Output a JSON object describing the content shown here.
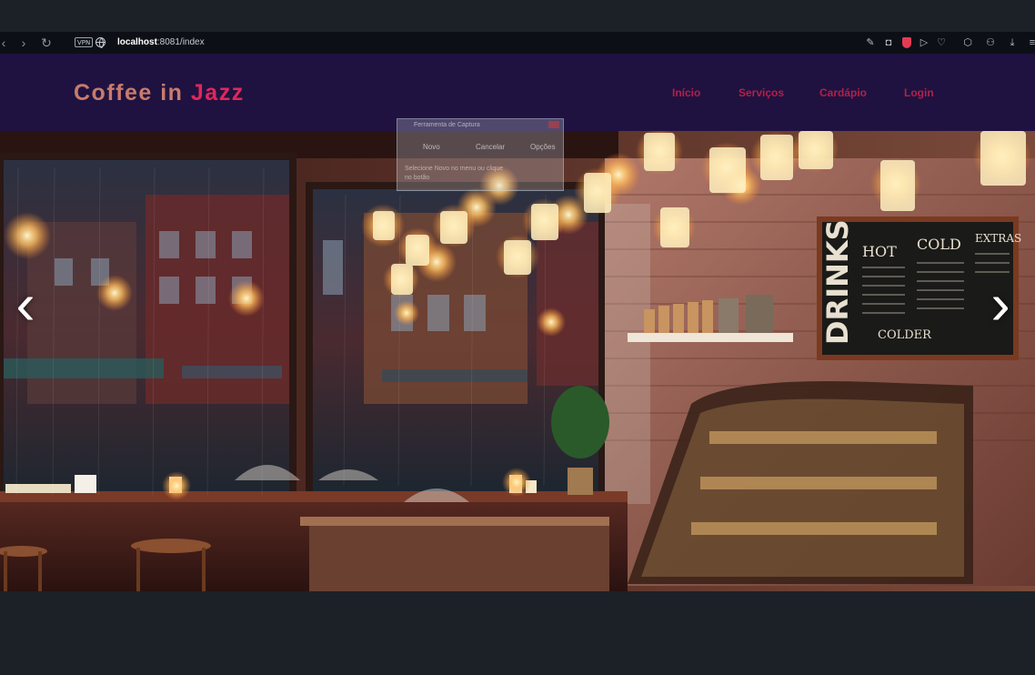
{
  "browser": {
    "back_icon": "chevron-left-icon",
    "forward_icon": "chevron-right-icon",
    "reload_icon": "reload-icon",
    "vpn_label": "VPN",
    "url_host": "localhost",
    "url_rest": ":8081/index"
  },
  "site": {
    "logo_word1": "Coffee in",
    "logo_word2": "Jazz",
    "nav": [
      "Início",
      "Serviços",
      "Cardápio",
      "Login"
    ],
    "colors": {
      "header_bg": "#1f1241",
      "nav_link": "#b32048",
      "logo_accent": "#e0275a",
      "logo_main": "#c87b6a"
    }
  },
  "carousel": {
    "prev_label": "‹",
    "next_label": "›",
    "slide_alt": "Jazz café interior at night with hanging jar lights and rainy window"
  },
  "chalkboard": {
    "title_vertical": "DRINKS",
    "col1": "HOT",
    "col2": "COLD",
    "col3": "EXTRAS",
    "footer": "COLDER"
  },
  "capture_tool": {
    "title": "Ferramenta de Captura",
    "new_label": "Novo",
    "cancel_label": "Cancelar",
    "options_label": "Opções",
    "hint": "Selecione Novo no menu ou clique no botão"
  }
}
